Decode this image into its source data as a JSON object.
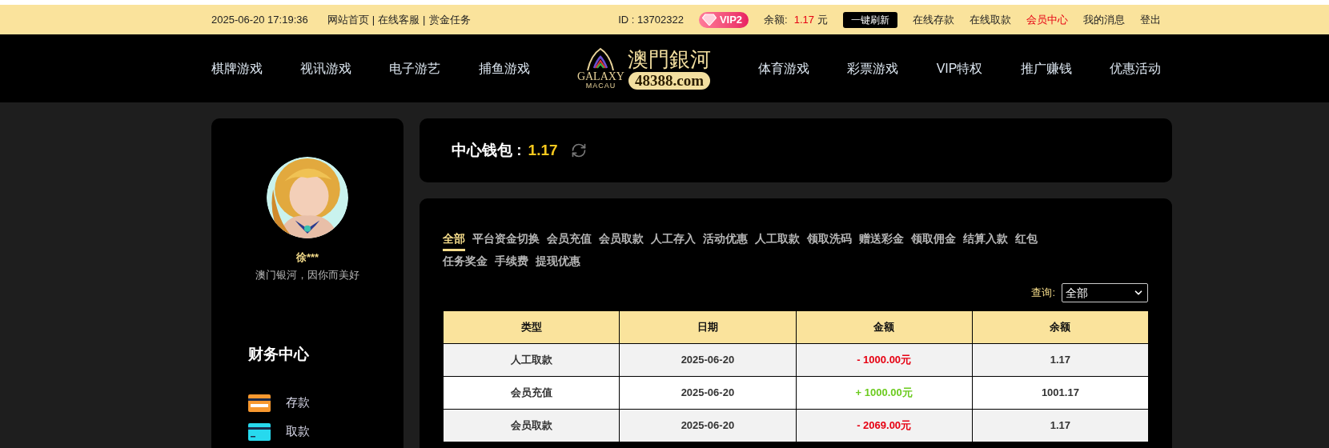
{
  "top_bar": {
    "datetime": "2025-06-20 17:19:36",
    "links": [
      "网站首页",
      "在线客服",
      "赏金任务"
    ],
    "separator": "|",
    "user_id": "ID : 13702322",
    "vip_badge": "VIP2",
    "balance_label": "余额:",
    "balance_value": "1.17",
    "balance_unit": "元",
    "refresh_button": "一键刷新",
    "actions": [
      {
        "label": "在线存款",
        "selected": false
      },
      {
        "label": "在线取款",
        "selected": false
      },
      {
        "label": "会员中心",
        "selected": true
      },
      {
        "label": "我的消息",
        "selected": false
      },
      {
        "label": "登出",
        "selected": false
      }
    ]
  },
  "nav": {
    "left": [
      "棋牌游戏",
      "视讯游戏",
      "电子游艺",
      "捕鱼游戏"
    ],
    "logo": {
      "brand": "澳門銀河",
      "domain": "48388.com",
      "galaxy": "GALAXY",
      "macau": "MACAU"
    },
    "right": [
      "体育游戏",
      "彩票游戏",
      "VIP特权",
      "推广赚钱",
      "优惠活动"
    ]
  },
  "profile": {
    "name": "徐***",
    "slogan": "澳门银河，因你而美好"
  },
  "sidebar": {
    "title": "财务中心",
    "items": [
      {
        "label": "存款",
        "color": "#f7982f"
      },
      {
        "label": "取款",
        "color": "#27d9ee"
      }
    ]
  },
  "wallet": {
    "label": "中心钱包 :",
    "value": "1.17"
  },
  "tabs": [
    {
      "label": "全部",
      "selected": true
    },
    {
      "label": "平台资金切换",
      "selected": false
    },
    {
      "label": "会员充值",
      "selected": false
    },
    {
      "label": "会员取款",
      "selected": false
    },
    {
      "label": "人工存入",
      "selected": false
    },
    {
      "label": "活动优惠",
      "selected": false
    },
    {
      "label": "人工取款",
      "selected": false
    },
    {
      "label": "领取洗码",
      "selected": false
    },
    {
      "label": "赠送彩金",
      "selected": false
    },
    {
      "label": "领取佣金",
      "selected": false
    },
    {
      "label": "结算入款",
      "selected": false
    },
    {
      "label": "红包",
      "selected": false
    },
    {
      "label": "任务奖金",
      "selected": false
    },
    {
      "label": "手续费",
      "selected": false
    },
    {
      "label": "提现优惠",
      "selected": false
    }
  ],
  "filter": {
    "label": "查询:",
    "value": "全部"
  },
  "table": {
    "columns": [
      "类型",
      "日期",
      "金额",
      "余额"
    ],
    "rows": [
      {
        "type": "人工取款",
        "date": "2025-06-20",
        "amount": "- 1000.00元",
        "kind": "debit",
        "balance": "1.17"
      },
      {
        "type": "会员充值",
        "date": "2025-06-20",
        "amount": "+ 1000.00元",
        "kind": "credit",
        "balance": "1001.17"
      },
      {
        "type": "会员取款",
        "date": "2025-06-20",
        "amount": "- 2069.00元",
        "kind": "debit",
        "balance": "1.17"
      }
    ]
  }
}
